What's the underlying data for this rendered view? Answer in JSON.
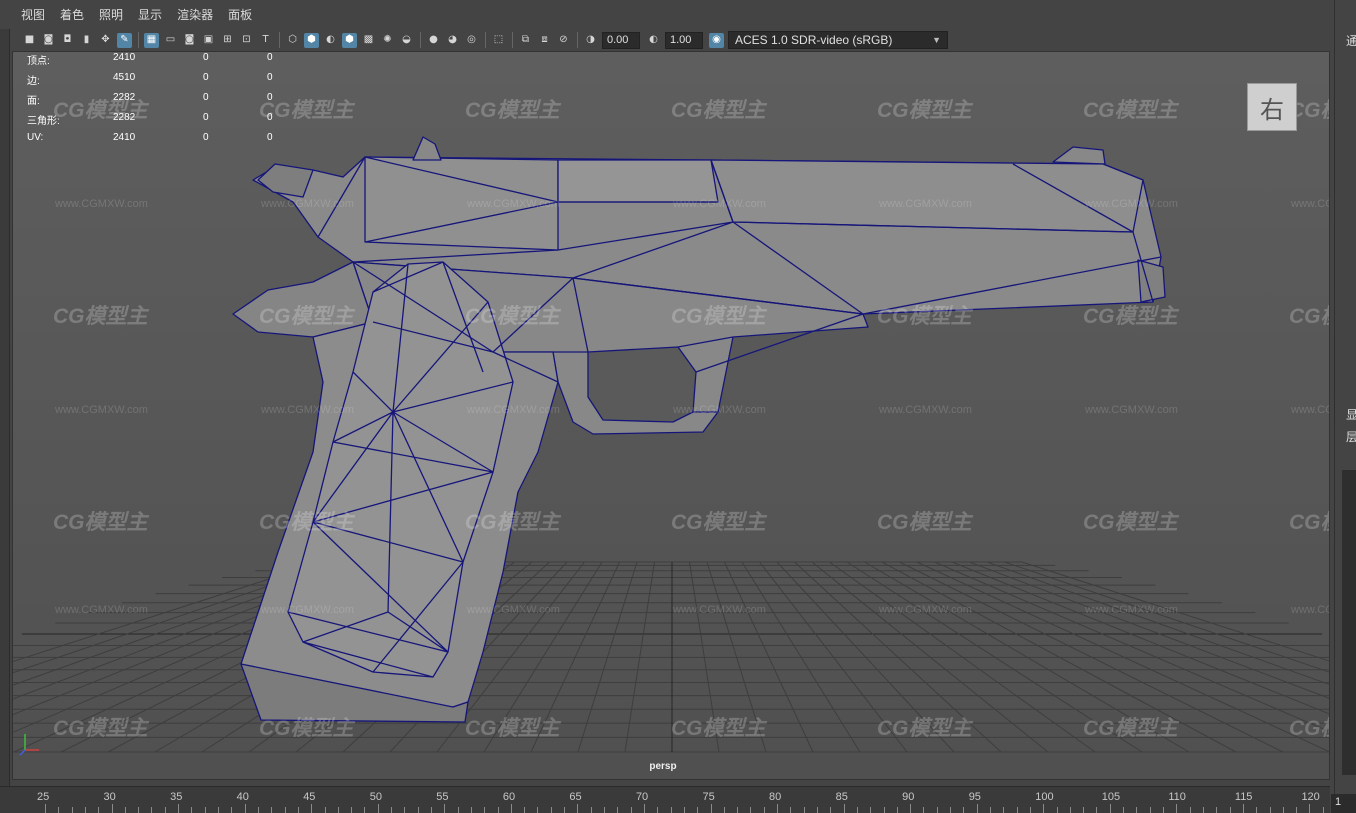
{
  "menu": [
    "视图",
    "着色",
    "照明",
    "显示",
    "渲染器",
    "面板"
  ],
  "toolbar": {
    "exposure_value": "0.00",
    "gamma_value": "1.00",
    "color_space": "ACES 1.0 SDR-video (sRGB)",
    "icons": [
      "camera-select-icon",
      "camera-attributes-icon",
      "bookmarks-icon",
      "image-plane-icon",
      "2d-pan-zoom-icon",
      "grease-pencil-icon",
      "grid-icon",
      "film-gate-icon",
      "resolution-gate-icon",
      "gate-mask-icon",
      "field-chart-icon",
      "safe-action-icon",
      "safe-title-icon",
      "wireframe-icon",
      "smooth-shade-icon",
      "flat-shade-icon",
      "wireframe-on-shaded-icon",
      "xray-icon",
      "use-default-material-icon",
      "lights-icon",
      "shadows-icon",
      "ambient-occlusion-icon",
      "motion-blur-icon",
      "anti-alias-icon",
      "isolate-select-icon",
      "xray-joints-icon",
      "xray-active-icon",
      "texture-icon",
      "exposure-icon",
      "gamma-icon",
      "color-management-icon"
    ]
  },
  "hud": {
    "rows": [
      {
        "label": "顶点:",
        "c1": "2410",
        "c2": "0",
        "c3": "0"
      },
      {
        "label": "边:",
        "c1": "4510",
        "c2": "0",
        "c3": "0"
      },
      {
        "label": "面:",
        "c1": "2282",
        "c2": "0",
        "c3": "0"
      },
      {
        "label": "三角形:",
        "c1": "2282",
        "c2": "0",
        "c3": "0"
      },
      {
        "label": "UV:",
        "c1": "2410",
        "c2": "0",
        "c3": "0"
      }
    ]
  },
  "viewcube_label": "右",
  "camera_label": "persp",
  "watermark_text": "CG模型主",
  "watermark_url": "www.CGMXW.com",
  "right_panel_chars": [
    "通",
    "显",
    "层"
  ],
  "timeline": {
    "labels": [
      "25",
      "30",
      "35",
      "40",
      "45",
      "50",
      "55",
      "60",
      "65",
      "70",
      "75",
      "80",
      "85",
      "90",
      "95",
      "100",
      "105",
      "110",
      "115",
      "120"
    ],
    "current_frame": "1"
  },
  "colors": {
    "viewport_bg": "#5a5a5a",
    "wire_color": "#1a1a7a",
    "mesh_fill": "#8c8c8c",
    "active_icon": "#5285a6"
  }
}
